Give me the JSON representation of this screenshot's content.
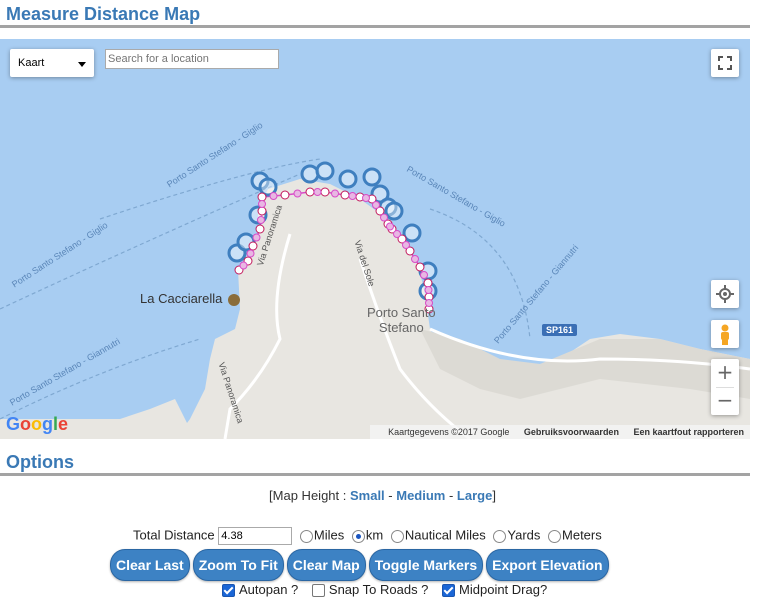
{
  "header": {
    "title": "Measure Distance Map"
  },
  "map": {
    "type_select": "Kaart",
    "search_placeholder": "Search for a location",
    "place_label": "La Cacciarella",
    "town_label_line1": "Porto Santo",
    "town_label_line2": "Stefano",
    "road_badge": "SP161",
    "roads": [
      "Via Panoramica",
      "Via Panoramica",
      "Via del Sole"
    ],
    "ferry_labels": [
      "Porto Santo Stefano - Giglio",
      "Porto Santo Stefano - Giglio",
      "Porto Santo Stefano - Giglio",
      "Porto Santo Stefano - Giannutri",
      "Porto Santo Stefano - Giannutri"
    ],
    "attribution": {
      "data": "Kaartgegevens ©2017 Google",
      "terms": "Gebruiksvoorwaarden",
      "report": "Een kaartfout rapporteren"
    },
    "logo": "Google",
    "zoom_in": "+",
    "zoom_out": "−"
  },
  "options": {
    "title": "Options",
    "height_prefix": "[Map Height : ",
    "small": "Small",
    "medium": "Medium",
    "large": "Large",
    "dash": " - ",
    "height_suffix": "]",
    "total_label": "Total Distance",
    "total_value": "4.38",
    "units": [
      "Miles",
      "km",
      "Nautical Miles",
      "Yards",
      "Meters"
    ],
    "selected_unit": "km",
    "buttons": [
      "Clear Last",
      "Zoom To Fit",
      "Clear Map",
      "Toggle Markers",
      "Export Elevation"
    ],
    "checks": [
      {
        "label": "Autopan ?",
        "checked": true
      },
      {
        "label": "Snap To Roads ?",
        "checked": false
      },
      {
        "label": "Midpoint Drag?",
        "checked": true
      }
    ]
  },
  "colors": {
    "heading": "#3a79b5",
    "water": "#a8cdf2",
    "land": "#e8e6e1",
    "marker": "#3f7fbf",
    "route": "#d84cc8",
    "button": "#3d82c4"
  }
}
